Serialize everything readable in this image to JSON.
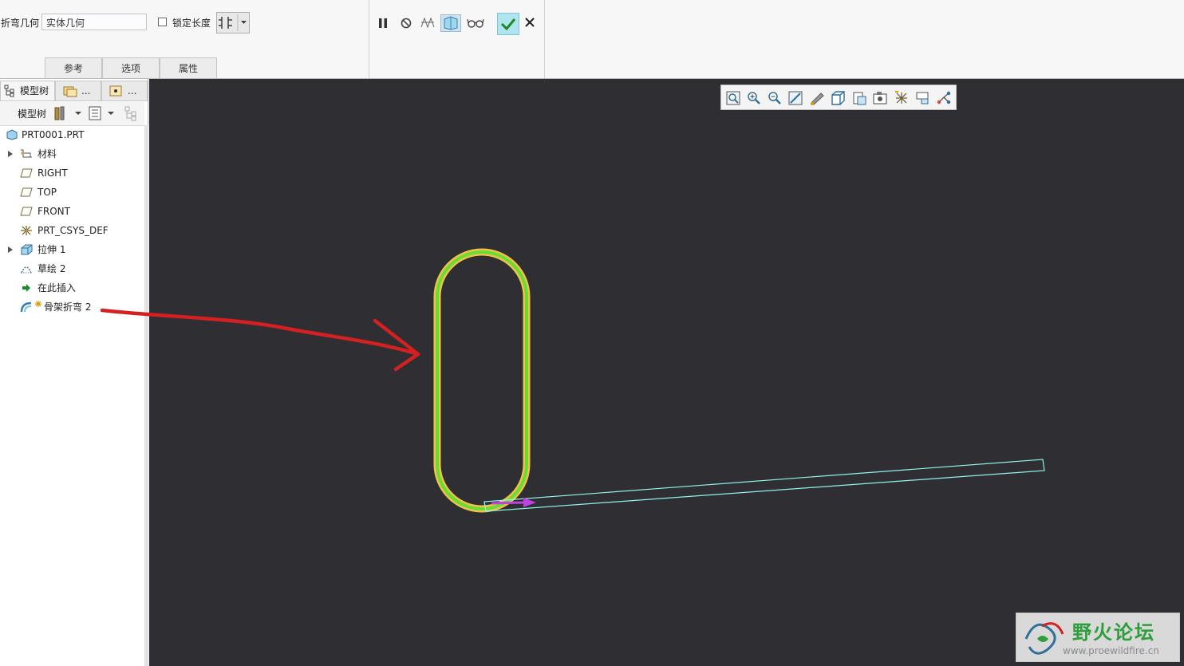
{
  "dashboard": {
    "bend_geometry_label": "折弯几何",
    "bend_geometry_value": "实体几何",
    "lock_length_label": "锁定长度",
    "lock_length_checked": false,
    "tabs": [
      {
        "label": "参考"
      },
      {
        "label": "选项"
      },
      {
        "label": "属性"
      }
    ]
  },
  "panel": {
    "tabs": [
      {
        "label": "模型树"
      },
      {
        "label": "..."
      },
      {
        "label": "..."
      }
    ],
    "tree_header_label": "模型树",
    "tree": [
      {
        "label": "PRT0001.PRT",
        "icon": "part-icon",
        "expandable": false
      },
      {
        "label": "材料",
        "icon": "material-icon",
        "expandable": true
      },
      {
        "label": "RIGHT",
        "icon": "datum-plane-icon",
        "expandable": false
      },
      {
        "label": "TOP",
        "icon": "datum-plane-icon",
        "expandable": false
      },
      {
        "label": "FRONT",
        "icon": "datum-plane-icon",
        "expandable": false
      },
      {
        "label": "PRT_CSYS_DEF",
        "icon": "csys-icon",
        "expandable": false
      },
      {
        "label": "拉伸 1",
        "icon": "extrude-icon",
        "expandable": true
      },
      {
        "label": "草绘 2",
        "icon": "sketch-icon",
        "expandable": false
      },
      {
        "label": "在此插入",
        "icon": "insert-here-arrow-icon",
        "expandable": false
      },
      {
        "label": "骨架折弯 2",
        "icon": "spinal-bend-icon",
        "expandable": false
      }
    ]
  },
  "watermark": {
    "title": "野火论坛",
    "url": "www.proewildfire.cn"
  },
  "colors": {
    "viewport_bg": "#2e2e33",
    "profile_outer": "#f2c14a",
    "profile_inner": "#66dd33",
    "body_edges": "#8ff3ea",
    "direction_arrow": "#c040e0",
    "annotation_red": "#d42020",
    "ok_button": "#aee5ee"
  }
}
